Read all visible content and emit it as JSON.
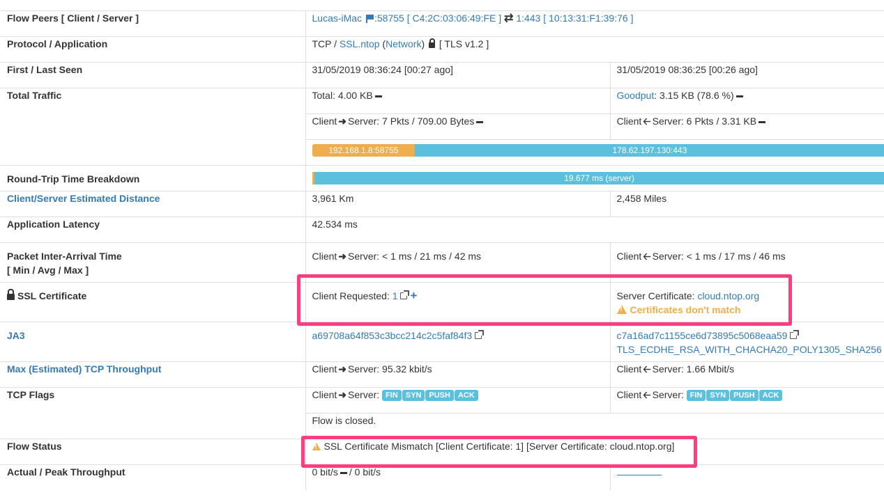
{
  "rows": {
    "peers": {
      "label": "Flow Peers [ Client / Server ]",
      "client_host": "Lucas-iMac",
      "client_port": ":58755",
      "client_mac": "C4:2C:03:06:49:FE",
      "server_port": "1:443",
      "server_mac": "10:13:31:F1:39:76"
    },
    "protocol": {
      "label": "Protocol / Application",
      "proto": "TCP",
      "app": "SSL.ntop",
      "category": "Network",
      "tls": "[ TLS v1.2 ]"
    },
    "seen": {
      "label": "First / Last Seen",
      "first": "31/05/2019 08:36:24 [00:27 ago]",
      "last": "31/05/2019 08:36:25 [00:26 ago]"
    },
    "traffic": {
      "label": "Total Traffic",
      "total": "Total: 4.00 KB",
      "goodput_label": "Goodput",
      "goodput_value": ": 3.15 KB (78.6 %)",
      "c2s_prefix": "Client",
      "c2s_value": "Server: 7 Pkts / 709.00 Bytes",
      "s2c_prefix": "Client",
      "s2c_value": "Server: 6 Pkts / 3.31 KB",
      "bar_client": "192.168.1.8:58755",
      "bar_server": "178.62.197.130:443",
      "bar_client_fraction": 0.18
    },
    "rtt": {
      "label": "Round-Trip Time Breakdown",
      "bar_text": "19.677 ms (server)"
    },
    "distance": {
      "label": "Client/Server Estimated Distance",
      "km": "3,961 Km",
      "miles": "2,458 Miles"
    },
    "latency": {
      "label": "Application Latency",
      "value": "42.534 ms"
    },
    "iat": {
      "label_line1": "Packet Inter-Arrival Time",
      "label_line2": "[ Min / Avg / Max ]",
      "c2s_prefix": "Client",
      "c2s_value": "Server: < 1 ms / 21 ms / 42 ms",
      "s2c_prefix": "Client",
      "s2c_value": "Server: < 1 ms / 17 ms / 46 ms"
    },
    "ssl": {
      "label": "SSL Certificate",
      "client_requested_label": "Client Requested: ",
      "client_requested_value": "1",
      "server_cert_label": "Server Certificate: ",
      "server_cert_value": "cloud.ntop.org",
      "mismatch_warning": "Certificates don't match"
    },
    "ja3": {
      "label": "JA3",
      "client_hash": "a69708a64f853c3bcc214c2c5faf84f3",
      "server_hash": "c7a16ad7c1155ce6d73895c5068eaa59",
      "cipher": "TLS_ECDHE_RSA_WITH_CHACHA20_POLY1305_SHA256"
    },
    "throughput": {
      "label": "Max (Estimated) TCP Throughput",
      "c2s_prefix": "Client",
      "c2s_value": "Server: 95.32 kbit/s",
      "s2c_prefix": "Client",
      "s2c_value": "Server: 1.66 Mbit/s"
    },
    "flags": {
      "label": "TCP Flags",
      "c2s_prefix": "Client",
      "c2s_suffix": "Server:",
      "s2c_prefix": "Client",
      "s2c_suffix": "Server:",
      "badges": [
        "FIN",
        "SYN",
        "PUSH",
        "ACK"
      ],
      "closed": "Flow is closed."
    },
    "status": {
      "label": "Flow Status",
      "value": "SSL Certificate Mismatch [Client Certificate: 1] [Server Certificate: cloud.ntop.org]"
    },
    "actual": {
      "label": "Actual / Peak Throughput",
      "current": "0 bit/s",
      "peak": "/ 0 bit/s"
    }
  },
  "colors": {
    "link": "#337ab7",
    "bar_client": "#f0ad4e",
    "bar_server": "#5bc0de",
    "warning": "#f0ad4e",
    "highlight": "#ff3d7f"
  }
}
